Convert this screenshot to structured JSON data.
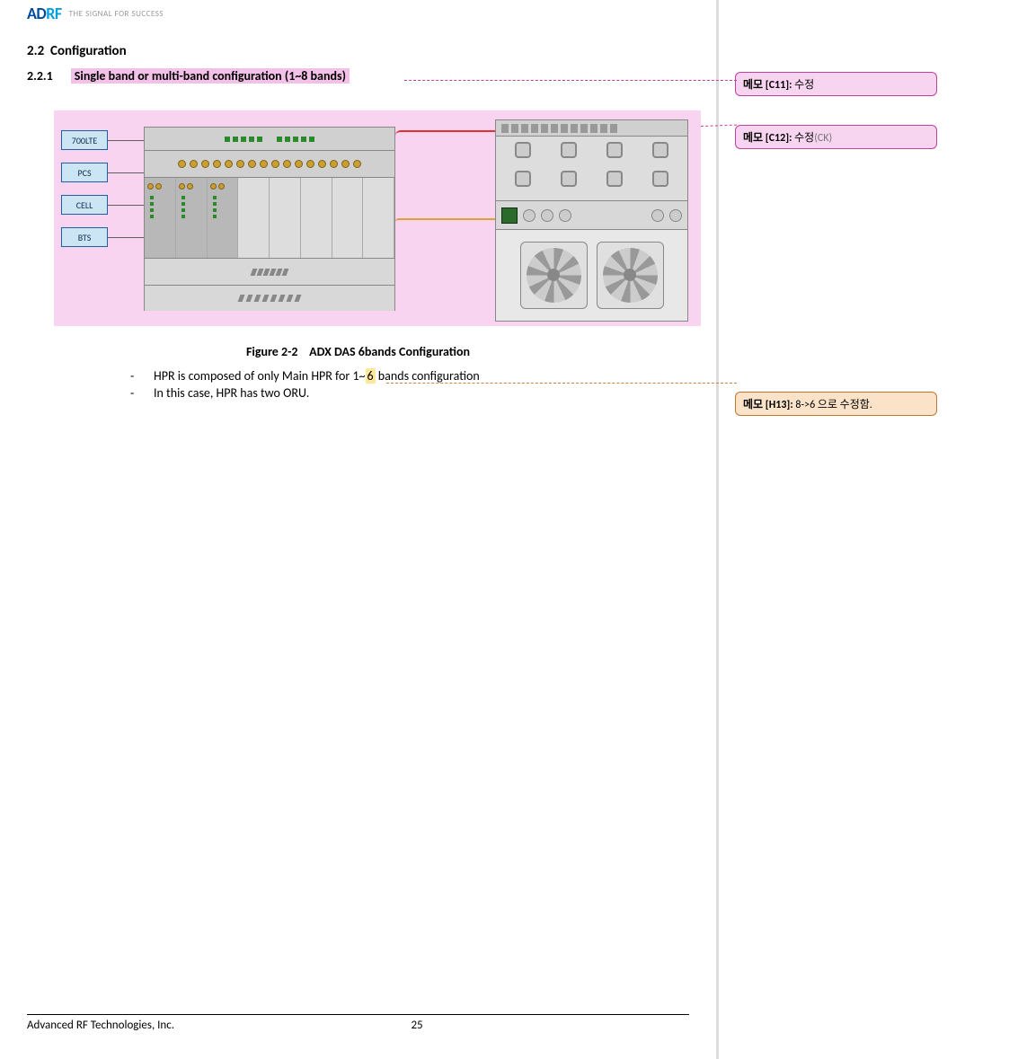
{
  "header": {
    "logo_left": "AD",
    "logo_right": "RF",
    "tagline": "THE SIGNAL FOR SUCCESS"
  },
  "section": {
    "number": "2.2",
    "title": "Configuration"
  },
  "subsection": {
    "number": "2.2.1",
    "title": "Single band or multi-band configuration (1~8 bands)"
  },
  "figure": {
    "caption_label": "Figure 2-2",
    "caption_text": "ADX DAS 6bands Configuration",
    "band_labels": [
      "700LTE",
      "PCS",
      "CELL",
      "BTS"
    ]
  },
  "bullets": {
    "item1_pre": "HPR is composed of only Main HPR for 1~",
    "item1_hl": "6",
    "item1_post": " bands configuration",
    "item2": "In this case, HPR has two ORU."
  },
  "footer": {
    "company": "Advanced RF Technologies, Inc.",
    "page": "25"
  },
  "comments": {
    "c11_label": "메모 [C11]: ",
    "c11_text": "수정",
    "c12_label": "메모 [C12]: ",
    "c12_text": "수정",
    "c12_suffix": "(CK)",
    "h13_label": "메모 [H13]: ",
    "h13_text": "8->6 으로 수정함."
  }
}
